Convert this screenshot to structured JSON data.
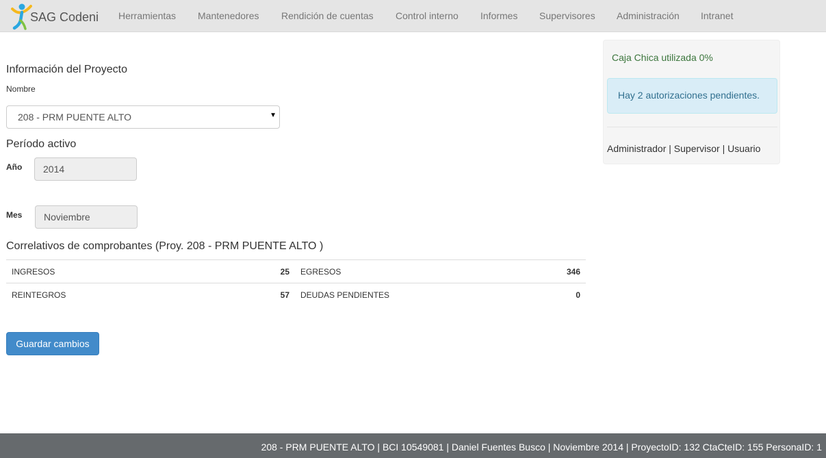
{
  "brand": {
    "name": "SAG Codeni"
  },
  "nav": {
    "items": [
      "Herramientas",
      "Mantenedores",
      "Rendición de cuentas",
      "Control interno",
      "Informes",
      "Supervisores",
      "Administración",
      "Intranet"
    ]
  },
  "project": {
    "section_title": "Información del Proyecto",
    "name_label": "Nombre",
    "selected": "208 - PRM PUENTE ALTO"
  },
  "period": {
    "section_title": "Período activo",
    "year_label": "Año",
    "year_value": "2014",
    "month_label": "Mes",
    "month_value": "Noviembre"
  },
  "correlatives": {
    "title": "Correlativos de comprobantes (Proy. 208 - PRM PUENTE ALTO )",
    "rows": [
      {
        "label_a": "INGRESOS",
        "value_a": "25",
        "label_b": "EGRESOS",
        "value_b": "346"
      },
      {
        "label_a": "REINTEGROS",
        "value_a": "57",
        "label_b": "DEUDAS PENDIENTES",
        "value_b": "0"
      }
    ]
  },
  "actions": {
    "save_label": "Guardar cambios"
  },
  "sidebar": {
    "caja_chica": "Caja Chica utilizada 0%",
    "alert": "Hay 2 autorizaciones pendientes.",
    "roles": [
      "Administrador",
      "Supervisor",
      "Usuario"
    ],
    "separator": " | "
  },
  "footer": {
    "text": "208 - PRM PUENTE ALTO | BCI 10549081 | Daniel Fuentes Busco | Noviembre 2014 | ProyectoID: 132 CtaCteID: 155 PersonaID: 1"
  },
  "colors": {
    "navbar_bg": "#e5e5e5",
    "primary": "#428bca",
    "success_text": "#3c763d",
    "info_bg": "#d9edf7",
    "footer_bg": "#666a6d"
  },
  "icons": {
    "brand_logo": "person-figure-logo",
    "select_caret": "caret-down-icon"
  }
}
